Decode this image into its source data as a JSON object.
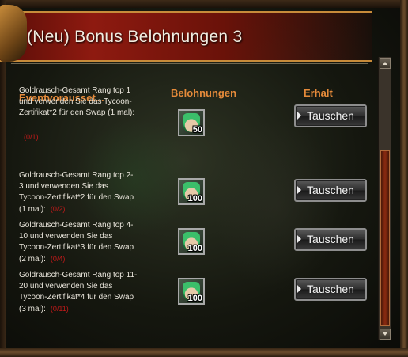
{
  "window": {
    "title": "(Neu) Bonus Belohnungen 3"
  },
  "columns": {
    "condition": "Eventvorausset...",
    "rewards": "Belohnungen",
    "receive": "Erhalt"
  },
  "rows": [
    {
      "description": "Goldrausch-Gesamt Rang top 1 und verwenden Sie das Tycoon-Zertifikat*2 für den Swap (1 mal):",
      "progress": "(0/1)",
      "reward_qty": "50",
      "button": "Tauschen"
    },
    {
      "description": "Goldrausch-Gesamt Rang top 2-3 und verwenden Sie das Tycoon-Zertifikat*2 für den Swap (1 mal):",
      "progress": "(0/2)",
      "reward_qty": "100",
      "button": "Tauschen"
    },
    {
      "description": "Goldrausch-Gesamt Rang top 4-10 und verwenden Sie das Tycoon-Zertifikat*3 für den Swap (2 mal):",
      "progress": "(0/4)",
      "reward_qty": "100",
      "button": "Tauschen"
    },
    {
      "description": "Goldrausch-Gesamt Rang top 11-20 und verwenden Sie das Tycoon-Zertifikat*4 für den Swap (3 mal):",
      "progress": "(0/11)",
      "reward_qty": "100",
      "button": "Tauschen"
    }
  ],
  "colors": {
    "accent": "#e58a3a",
    "progress": "#c21a1a",
    "title_bg": "#8e1a10"
  },
  "icons": {
    "reward": "character-portrait-icon",
    "button": "arrow-right-icon"
  }
}
